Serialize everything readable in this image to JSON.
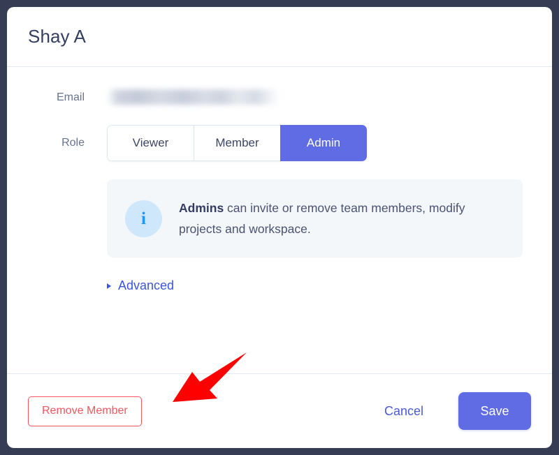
{
  "dialog": {
    "title": "Shay A"
  },
  "form": {
    "email": {
      "label": "Email",
      "value": "",
      "redacted": true
    },
    "role": {
      "label": "Role",
      "options": [
        "Viewer",
        "Member",
        "Admin"
      ],
      "selected": "Admin"
    }
  },
  "callout": {
    "icon": "info-icon",
    "emphasis": "Admins",
    "text": " can invite or remove team members, modify projects and workspace."
  },
  "advanced": {
    "label": "Advanced",
    "expanded": false
  },
  "footer": {
    "remove_label": "Remove Member",
    "cancel_label": "Cancel",
    "save_label": "Save"
  },
  "annotation": {
    "arrow_color": "#ff0000",
    "points_to": "Remove Member"
  },
  "colors": {
    "accent": "#5f6ce4",
    "link": "#3a55de",
    "danger": "#f4555e",
    "info": "#2196f3",
    "backdrop": "#363c54",
    "title": "#343e63"
  }
}
